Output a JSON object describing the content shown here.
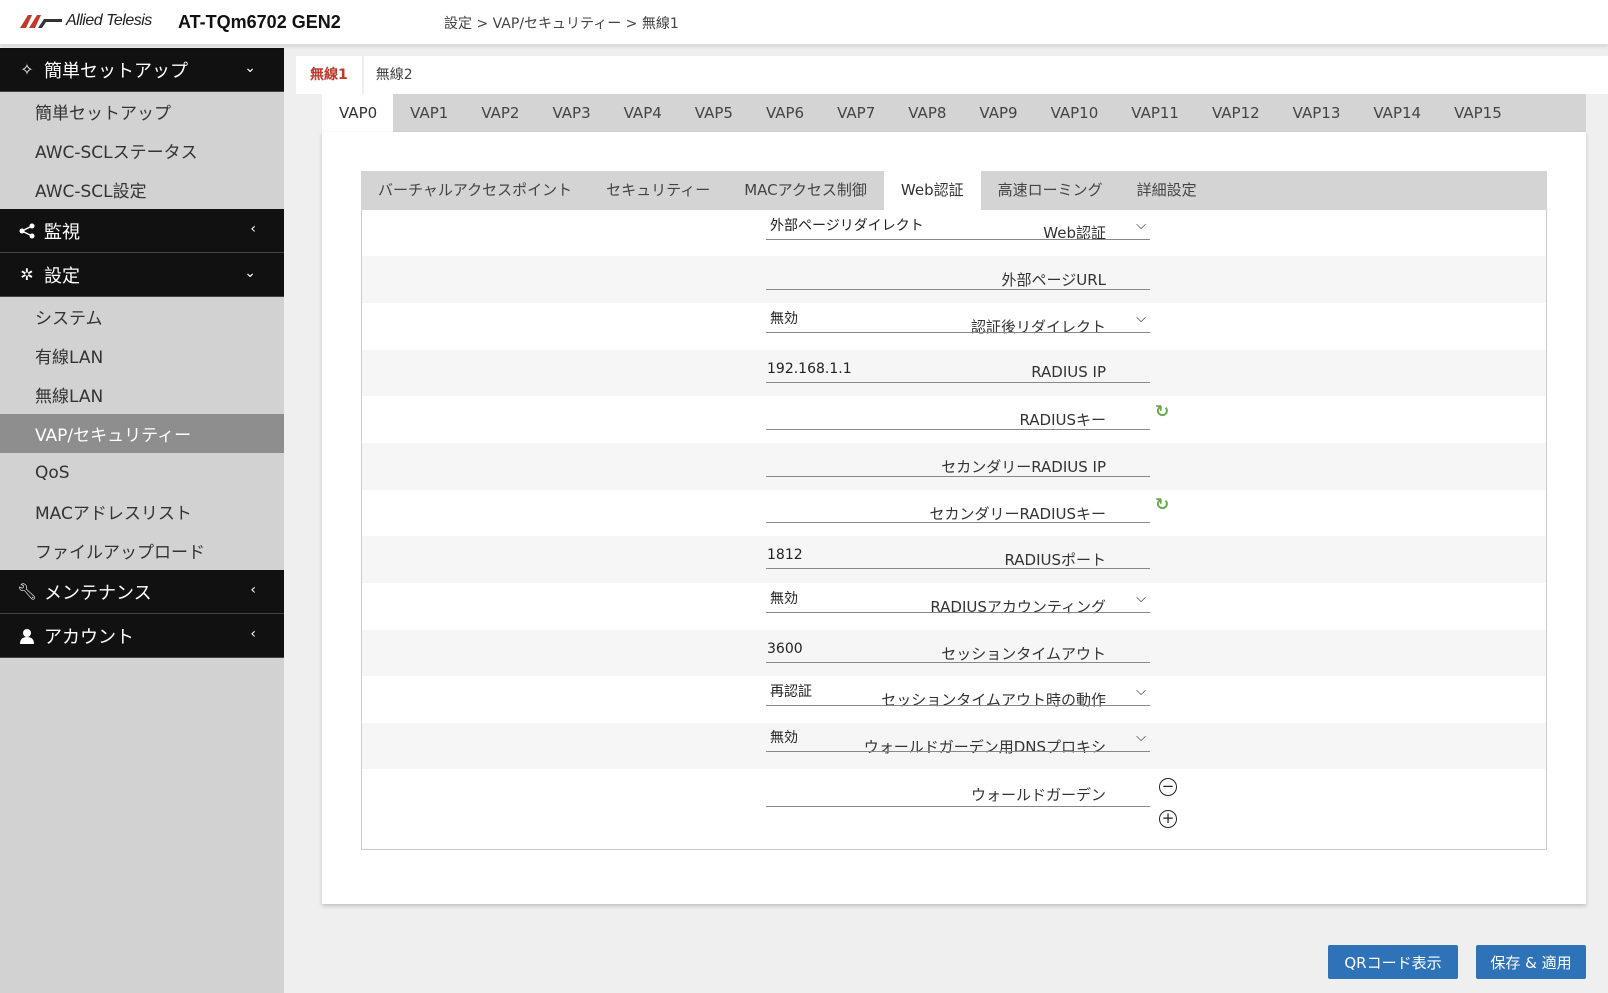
{
  "header": {
    "logo_text": "Allied Telesis",
    "product": "AT-TQm6702 GEN2",
    "breadcrumb": "設定 > VAP/セキュリティー > 無線1"
  },
  "sidebar": {
    "sections": [
      {
        "label": "簡単セットアップ",
        "icon": "magic-wand-icon",
        "arrow": "⌄"
      },
      {
        "label": "監視",
        "icon": "share-icon",
        "arrow": "‹"
      },
      {
        "label": "設定",
        "icon": "gear-icon",
        "arrow": "⌄"
      },
      {
        "label": "メンテナンス",
        "icon": "wrench-icon",
        "arrow": "‹"
      },
      {
        "label": "アカウント",
        "icon": "user-icon",
        "arrow": "‹"
      }
    ],
    "setup_items": [
      "簡単セットアップ",
      "AWC-SCLステータス",
      "AWC-SCL設定"
    ],
    "config_items": [
      "システム",
      "有線LAN",
      "無線LAN",
      "VAP/セキュリティー",
      "QoS",
      "MACアドレスリスト",
      "ファイルアップロード"
    ],
    "active_item": "VAP/セキュリティー"
  },
  "radio_tabs": [
    "無線1",
    "無線2"
  ],
  "vap_tabs": [
    "VAP0",
    "VAP1",
    "VAP2",
    "VAP3",
    "VAP4",
    "VAP5",
    "VAP6",
    "VAP7",
    "VAP8",
    "VAP9",
    "VAP10",
    "VAP11",
    "VAP12",
    "VAP13",
    "VAP14",
    "VAP15"
  ],
  "sub_tabs": [
    "バーチャルアクセスポイント",
    "セキュリティー",
    "MACアクセス制御",
    "Web認証",
    "高速ローミング",
    "詳細設定"
  ],
  "form": {
    "web_auth_label": "Web認証",
    "web_auth_value": "外部ページリダイレクト",
    "ext_url_label": "外部ページURL",
    "ext_url_value": "",
    "post_redirect_label": "認証後リダイレクト",
    "post_redirect_value": "無効",
    "radius_ip_label": "RADIUS IP",
    "radius_ip_value": "192.168.1.1",
    "radius_key_label": "RADIUSキー",
    "radius_key_value": "",
    "sec_radius_ip_label": "セカンダリーRADIUS IP",
    "sec_radius_ip_value": "",
    "sec_radius_key_label": "セカンダリーRADIUSキー",
    "sec_radius_key_value": "",
    "radius_port_label": "RADIUSポート",
    "radius_port_value": "1812",
    "radius_acct_label": "RADIUSアカウンティング",
    "radius_acct_value": "無効",
    "session_timeout_label": "セッションタイムアウト",
    "session_timeout_value": "3600",
    "timeout_action_label": "セッションタイムアウト時の動作",
    "timeout_action_value": "再認証",
    "wg_dns_label": "ウォールドガーデン用DNSプロキシ",
    "wg_dns_value": "無効",
    "wg_label": "ウォールドガーデン",
    "wg_value": ""
  },
  "buttons": {
    "qr": "QRコード表示",
    "save": "保存 & 適用"
  },
  "colors": {
    "accent": "#2e73b8",
    "active_radio": "#c0392b",
    "sidebar_dark": "#111111",
    "refresh_icon": "#6aa84f"
  }
}
